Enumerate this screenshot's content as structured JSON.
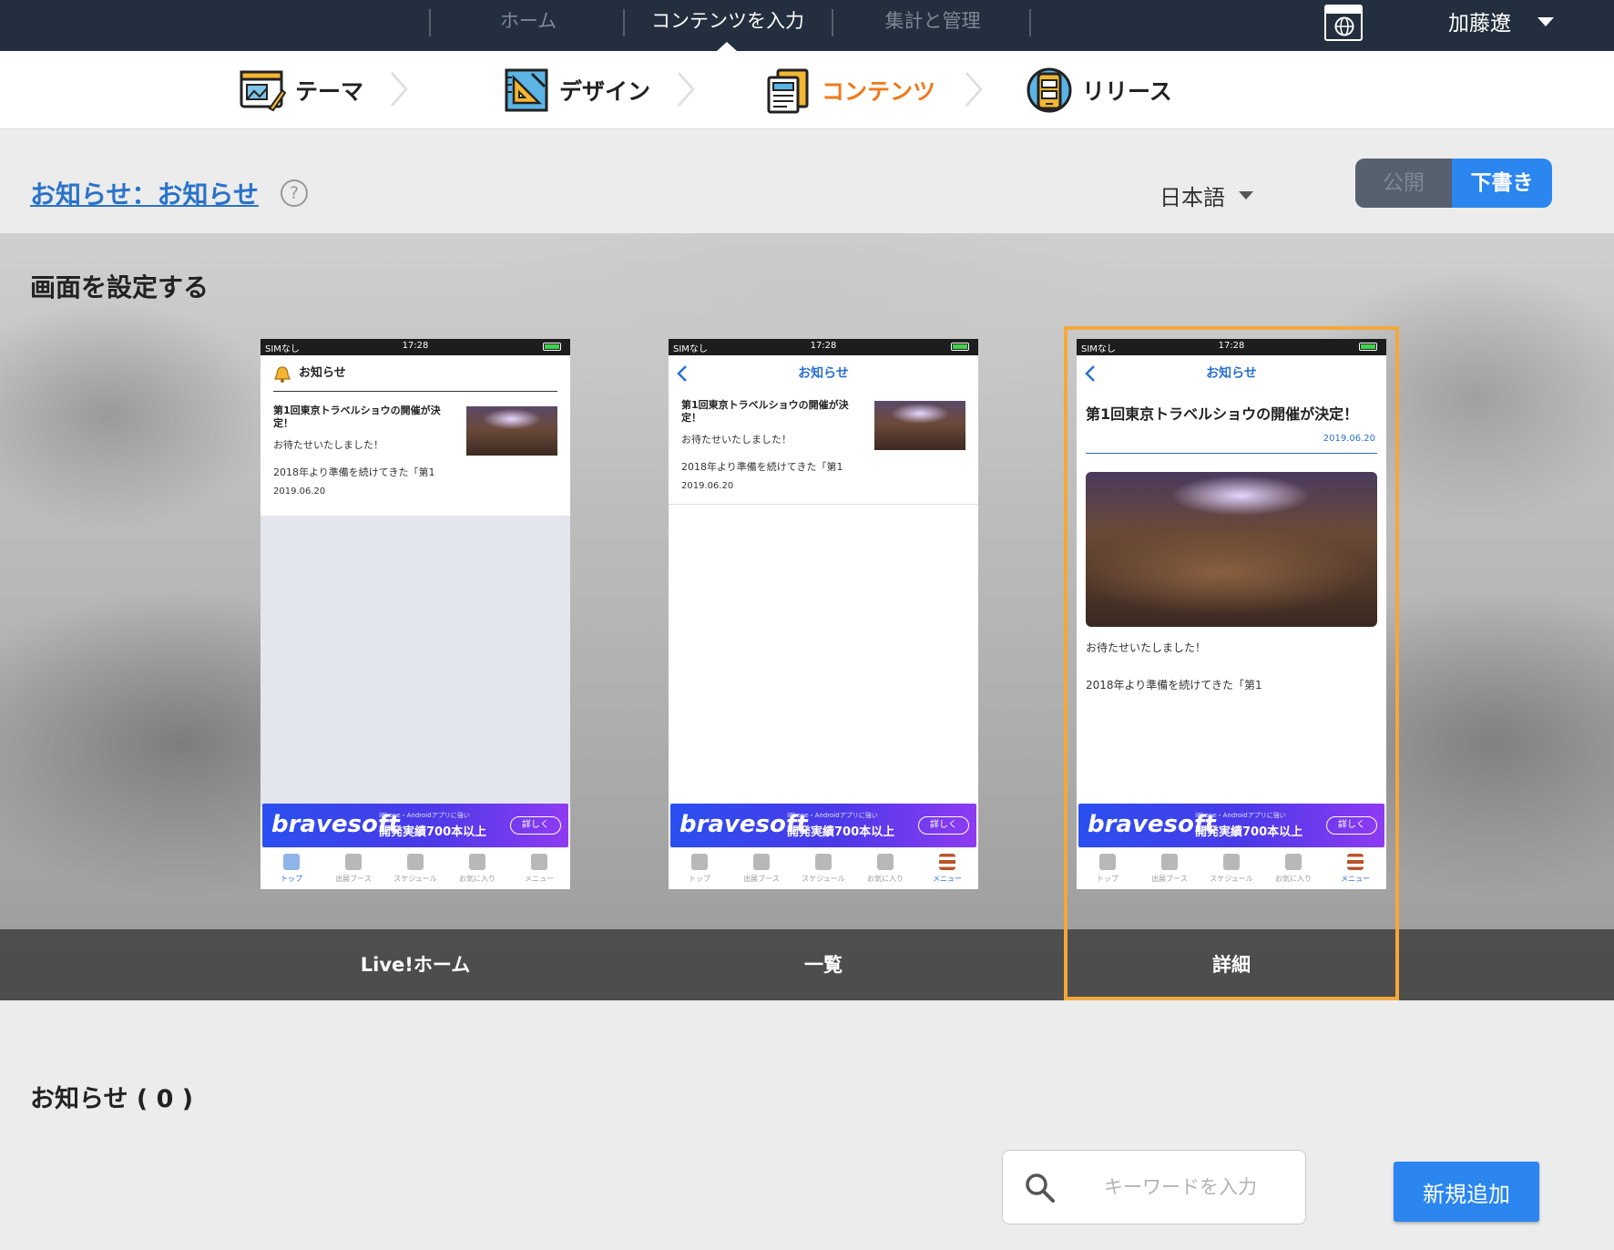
{
  "topnav": {
    "tabs": [
      {
        "label": "ホーム",
        "active": false
      },
      {
        "label": "コンテンツを入力",
        "active": true
      },
      {
        "label": "集計と管理",
        "active": false
      }
    ],
    "user_name": "加藤遼",
    "icons": {
      "globe": "globe-window-icon",
      "user_menu": "caret-down-icon"
    }
  },
  "steps": [
    {
      "label": "テーマ",
      "icon": "theme-icon",
      "active": false
    },
    {
      "label": "デザイン",
      "icon": "design-icon",
      "active": false
    },
    {
      "label": "コンテンツ",
      "icon": "content-icon",
      "active": true
    },
    {
      "label": "リリース",
      "icon": "release-icon",
      "active": false
    }
  ],
  "title_row": {
    "title": "お知らせ：お知らせ",
    "help": "?",
    "language": "日本語",
    "publish_label": "公開",
    "draft_label": "下書き"
  },
  "screens": {
    "section_title": "画面を設定する",
    "status": {
      "carrier": "SIMなし",
      "time": "17:28"
    },
    "nav_title": "お知らせ",
    "item": {
      "title": "第1回東京トラベルショウの開催が決定！",
      "subtitle": "お待たせいたしました！",
      "body": "2018年より準備を続けてきた「第1",
      "date": "2019.06.20"
    },
    "banner": {
      "brand": "bravesoft",
      "small": "iPhone・Androidアプリに強い",
      "main": "開発実績700本以上",
      "button": "詳しく"
    },
    "tabs": [
      "トップ",
      "出展ブース",
      "スケジュール",
      "お気に入り",
      "メニュー"
    ],
    "labels": [
      "Live!ホーム",
      "一覧",
      "詳細"
    ],
    "selected_index": 2
  },
  "list": {
    "title": "お知らせ ( 0 )",
    "search_placeholder": "キーワードを入力",
    "add_label": "新規追加"
  },
  "colors": {
    "nav_bg": "#232f3e",
    "accent_blue": "#2b86f0",
    "step_active": "#ee7a1e",
    "selection": "#f3a83a",
    "link": "#2a73c9"
  }
}
